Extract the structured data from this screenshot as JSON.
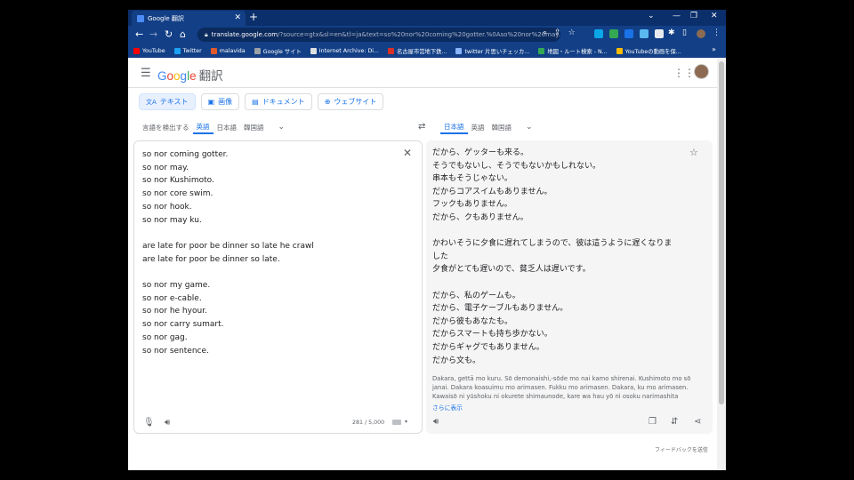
{
  "browser": {
    "tab_title": "Google 翻訳",
    "tab_close": "✕",
    "new_tab": "+",
    "url_host": "translate.google.com",
    "url_rest": "/?source=gtx&sl=en&tl=ja&text=so%20nor%20coming%20gotter.%0Aso%20nor%20may...",
    "bookmarks": [
      {
        "label": "YouTube",
        "color": "#ff0000"
      },
      {
        "label": "Twitter",
        "color": "#1da1f2"
      },
      {
        "label": "malavida",
        "color": "#e05a2b"
      },
      {
        "label": "Google サイト",
        "color": "#9aa0a6"
      },
      {
        "label": "Internet Archive: Di...",
        "color": "#e0e0e0"
      },
      {
        "label": "名古屋市営地下鉄...",
        "color": "#d93025"
      },
      {
        "label": "twitter 片思いチェッカ...",
        "color": "#8ab4f8"
      },
      {
        "label": "地図・ルート検索 - N...",
        "color": "#34a853"
      },
      {
        "label": "YouTubeの動画を保...",
        "color": "#fbbc05"
      }
    ],
    "bookmarks_more": "»"
  },
  "header": {
    "logo_letters": [
      "G",
      "o",
      "o",
      "g",
      "l",
      "e"
    ],
    "logo_suffix": "翻訳"
  },
  "modes": [
    {
      "icon": "文A",
      "label": "テキスト"
    },
    {
      "icon": "▣",
      "label": "画像"
    },
    {
      "icon": "▤",
      "label": "ドキュメント"
    },
    {
      "icon": "⊕",
      "label": "ウェブサイト"
    }
  ],
  "source_langs": [
    "言語を検出する",
    "英語",
    "日本語",
    "韓国語"
  ],
  "target_langs": [
    "日本語",
    "英語",
    "韓国語"
  ],
  "source_text": "so nor coming gotter.\nso nor may.\nso nor Kushimoto.\nso nor core swim.\nso nor hook.\nso nor may ku.\n\nare late for poor be dinner so late he crawl\nare late for poor be dinner so late.\n\nso nor my game.\nso nor e-cable.\nso nor he hyour.\nso nor carry sumart.\nso nor gag.\nso nor sentence.",
  "translated_text": "だから、ゲッターも来る。\nそうでもないし、そうでもないかもしれない。\n串本もそうじゃない。\nだからコアスイムもありません。\nフックもありません。\nだから、クもありません。\n\nかわいそうに夕食に遅れてしまうので、彼は這うように遅くなりま\nした\n夕食がとても遅いので、貧乏人は遅いです。\n\nだから、私のゲームも。\nだから、電子ケーブルもありません。\nだから彼もあなたも。\nだからスマートも持ち歩かない。\nだからギャグでもありません。\nだから文も。",
  "romanization": "Dakara, gettā mo kuru. Sō demonaishi,-sōde mo nai kamo shirenai. Kushimoto mo sō\njanai. Dakara koasuimu mo arimasen. Fukku mo arimasen. Dakara, ku mo arimasen.\nKawaisō ni yūshoku ni okurete shimaunode, kare wa hau yō ni osoku narimashita",
  "show_more": "さらに表示",
  "char_count": "281 / 5,000",
  "feedback": "フィードバックを送信",
  "colors": {
    "browser_dark": "#0b2f6b",
    "browser_mid": "#123f86",
    "accent": "#1a73e8"
  }
}
